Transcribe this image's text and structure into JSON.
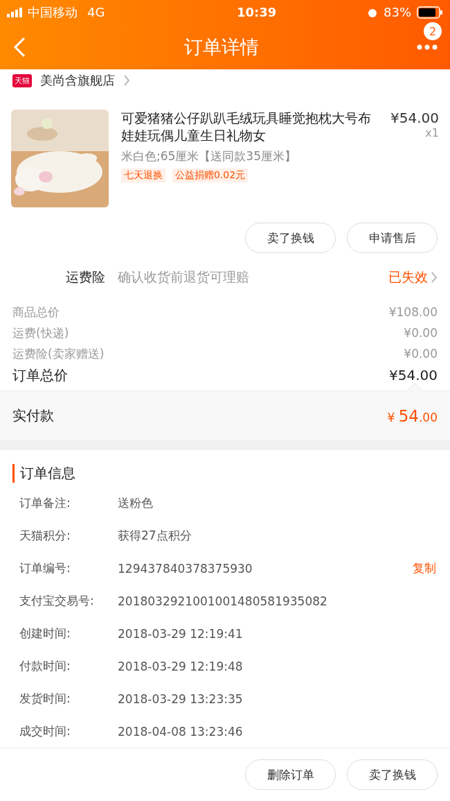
{
  "status_bar": {
    "carrier": "中国移动",
    "network": "4G",
    "time": "10:39",
    "battery": "83%"
  },
  "nav": {
    "title": "订单详情",
    "badge": "2"
  },
  "store": {
    "tag": "天猫",
    "name": "美尚含旗舰店"
  },
  "product": {
    "title": "可爱猪猪公仔趴趴毛绒玩具睡觉抱枕大号布娃娃玩偶儿童生日礼物女",
    "price": "¥54.00",
    "quantity": "x1",
    "spec": "米白色;65厘米【送同款35厘米】",
    "tags": [
      "七天退换",
      "公益捐赠0.02元"
    ]
  },
  "product_actions": [
    "卖了换钱",
    "申请售后"
  ],
  "insurance": {
    "label": "运费险",
    "description": "确认收货前退货可理赔",
    "status": "已失效"
  },
  "summary": [
    {
      "label": "商品总价",
      "value": "¥108.00",
      "kind": "minor"
    },
    {
      "label": "运费(快递)",
      "value": "¥0.00",
      "kind": "minor"
    },
    {
      "label": "运费险(卖家赠送)",
      "value": "¥0.00",
      "kind": "minor"
    },
    {
      "label": "订单总价",
      "value": "¥54.00",
      "kind": "total"
    }
  ],
  "paid": {
    "label": "实付款",
    "currency": "¥",
    "integer": "54",
    "decimal": ".00"
  },
  "order_info": {
    "title": "订单信息",
    "rows": [
      {
        "label": "订单备注:",
        "value": "送粉色"
      },
      {
        "label": "天猫积分:",
        "value": "获得27点积分"
      },
      {
        "label": "订单编号:",
        "value": "129437840378375930",
        "action": "复制"
      },
      {
        "label": "支付宝交易号:",
        "value": "2018032921001001480581935082"
      },
      {
        "label": "创建时间:",
        "value": "2018-03-29 12:19:41"
      },
      {
        "label": "付款时间:",
        "value": "2018-03-29 12:19:48"
      },
      {
        "label": "发货时间:",
        "value": "2018-03-29 13:23:35"
      },
      {
        "label": "成交时间:",
        "value": "2018-04-08 13:23:46"
      }
    ]
  },
  "bottom_actions": [
    "删除订单",
    "卖了换钱"
  ]
}
